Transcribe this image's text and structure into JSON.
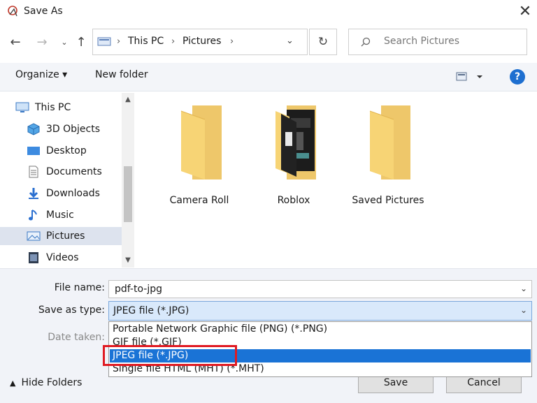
{
  "window": {
    "title": "Save As",
    "close_icon": "close-icon"
  },
  "nav": {
    "back_icon": "arrow-left-icon",
    "forward_icon": "arrow-right-icon",
    "recent_icon": "chevron-down-icon",
    "up_icon": "arrow-up-icon",
    "breadcrumb": [
      "This PC",
      "Pictures"
    ],
    "refresh_icon": "refresh-icon",
    "search_placeholder": "Search Pictures"
  },
  "toolbar": {
    "organize_label": "Organize ▾",
    "new_folder_label": "New folder",
    "view_icon": "view-options-icon",
    "help_label": "?"
  },
  "sidebar": {
    "items": [
      {
        "label": "This PC",
        "icon": "computer-icon",
        "selected": false
      },
      {
        "label": "3D Objects",
        "icon": "cube-icon",
        "selected": false
      },
      {
        "label": "Desktop",
        "icon": "desktop-icon",
        "selected": false
      },
      {
        "label": "Documents",
        "icon": "document-icon",
        "selected": false
      },
      {
        "label": "Downloads",
        "icon": "download-icon",
        "selected": false
      },
      {
        "label": "Music",
        "icon": "music-note-icon",
        "selected": false
      },
      {
        "label": "Pictures",
        "icon": "pictures-icon",
        "selected": true
      },
      {
        "label": "Videos",
        "icon": "film-icon",
        "selected": false
      }
    ]
  },
  "folders": [
    {
      "label": "Camera Roll",
      "icon": "folder-icon"
    },
    {
      "label": "Roblox",
      "icon": "folder-with-images-icon"
    },
    {
      "label": "Saved Pictures",
      "icon": "folder-icon"
    }
  ],
  "form": {
    "file_name_label": "File name:",
    "file_name_value": "pdf-to-jpg",
    "save_type_label": "Save as type:",
    "save_type_value": "JPEG file (*.JPG)",
    "date_taken_label": "Date taken:",
    "type_options": [
      "Portable Network Graphic file (PNG) (*.PNG)",
      "GIF file (*.GIF)",
      "JPEG file (*.JPG)",
      "Single file HTML (MHT) (*.MHT)"
    ],
    "selected_type_index": 2
  },
  "footer": {
    "hide_folders_label": "Hide Folders",
    "save_label": "Save",
    "cancel_label": "Cancel"
  },
  "colors": {
    "accent": "#1a73d6",
    "highlight_border": "#e01a22",
    "folder_yellow": "#f7d475"
  }
}
